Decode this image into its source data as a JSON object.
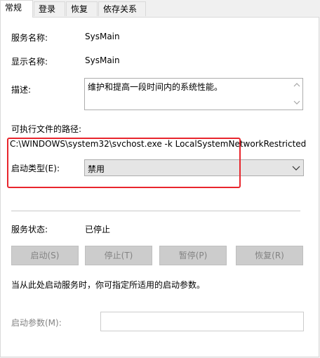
{
  "tabs": [
    {
      "label": "常规",
      "active": true
    },
    {
      "label": "登录",
      "active": false
    },
    {
      "label": "恢复",
      "active": false
    },
    {
      "label": "依存关系",
      "active": false
    }
  ],
  "general": {
    "service_name_label": "服务名称:",
    "service_name_value": "SysMain",
    "display_name_label": "显示名称:",
    "display_name_value": "SysMain",
    "description_label": "描述:",
    "description_value": "维护和提高一段时间内的系统性能。",
    "path_label": "可执行文件的路径:",
    "path_value": "C:\\WINDOWS\\system32\\svchost.exe -k LocalSystemNetworkRestricted -",
    "startup_type_label": "启动类型(E):",
    "startup_type_value": "禁用",
    "service_status_label": "服务状态:",
    "service_status_value": "已停止",
    "buttons": {
      "start": "启动(S)",
      "stop": "停止(T)",
      "pause": "暂停(P)",
      "resume": "恢复(R)"
    },
    "hint_text": "当从此处启动服务时，你可指定所适用的启动参数。",
    "start_params_label": "启动参数(M):",
    "start_params_value": ""
  },
  "colors": {
    "highlight": "#e8262d",
    "disabled_text": "#838383",
    "button_bg": "#cccccc",
    "select_bg": "#e5e5e5"
  },
  "icons": {
    "scroll_up": "chevron-up-icon",
    "scroll_down": "chevron-down-icon",
    "select_arrow": "chevron-down-icon"
  }
}
